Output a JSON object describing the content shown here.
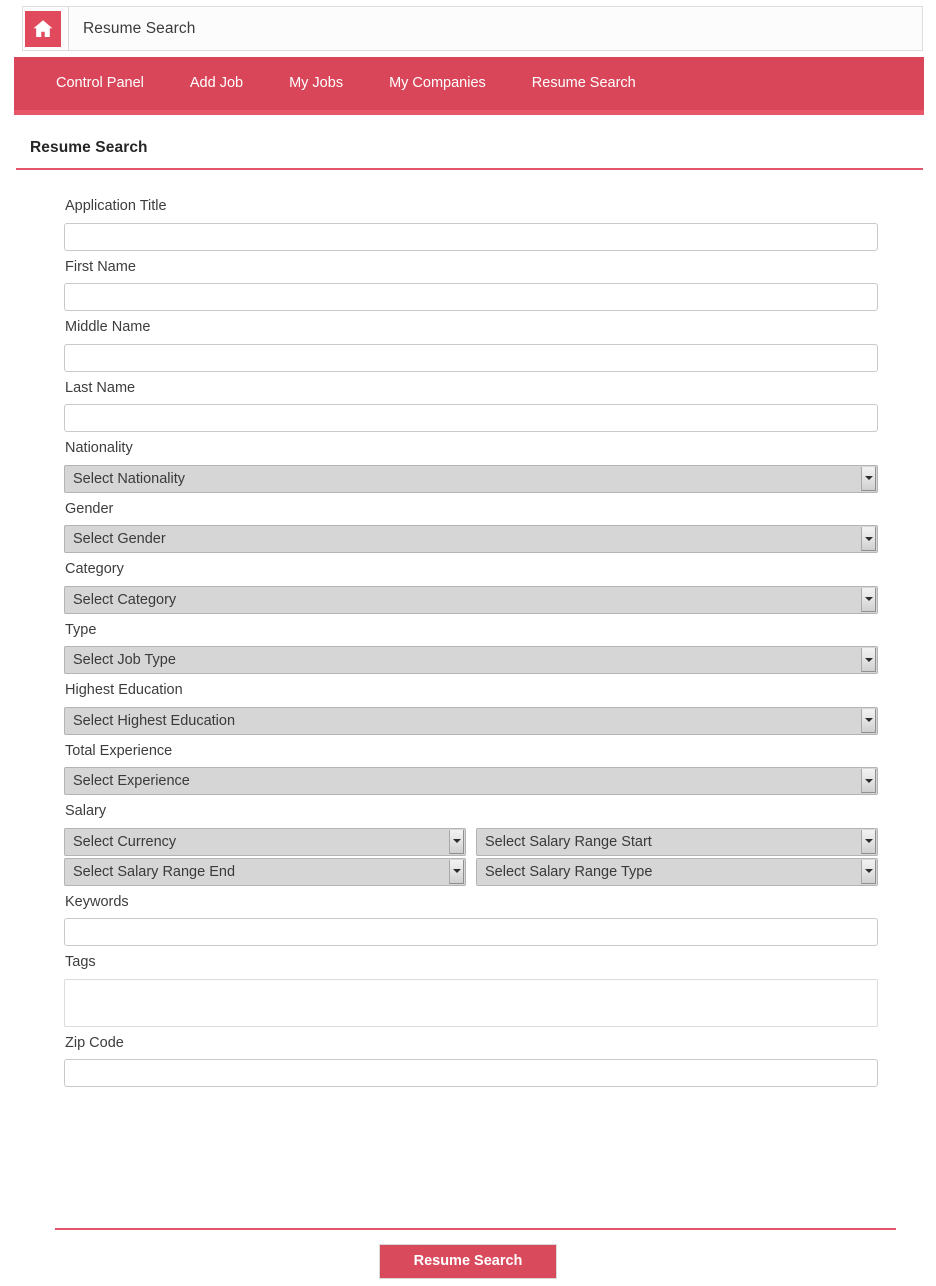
{
  "header": {
    "home_icon": "home-icon",
    "title": "Resume Search"
  },
  "nav": {
    "items": [
      {
        "label": "Control Panel",
        "name": "nav-item-control-panel"
      },
      {
        "label": "Add Job",
        "name": "nav-item-add-job"
      },
      {
        "label": "My Jobs",
        "name": "nav-item-my-jobs"
      },
      {
        "label": "My Companies",
        "name": "nav-item-my-companies"
      },
      {
        "label": "Resume Search",
        "name": "nav-item-resume-search"
      }
    ]
  },
  "page": {
    "heading": "Resume Search"
  },
  "form": {
    "application_title": {
      "label": "Application Title",
      "value": "",
      "placeholder": ""
    },
    "first_name": {
      "label": "First Name",
      "value": "",
      "placeholder": ""
    },
    "middle_name": {
      "label": "Middle Name",
      "value": "",
      "placeholder": ""
    },
    "last_name": {
      "label": "Last Name",
      "value": "",
      "placeholder": ""
    },
    "nationality": {
      "label": "Nationality",
      "selected": "Select Nationality"
    },
    "gender": {
      "label": "Gender",
      "selected": "Select Gender"
    },
    "category": {
      "label": "Category",
      "selected": "Select Category"
    },
    "type": {
      "label": "Type",
      "selected": "Select Job Type"
    },
    "highest_education": {
      "label": "Highest Education",
      "selected": "Select Highest Education"
    },
    "total_experience": {
      "label": "Total Experience",
      "selected": "Select Experience"
    },
    "salary": {
      "label": "Salary",
      "currency": "Select Currency",
      "range_start": "Select Salary Range Start",
      "range_end": "Select Salary Range End",
      "range_type": "Select Salary Range Type"
    },
    "keywords": {
      "label": "Keywords",
      "value": "",
      "placeholder": ""
    },
    "tags": {
      "label": "Tags",
      "value": "",
      "placeholder": ""
    },
    "zip_code": {
      "label": "Zip Code",
      "value": "",
      "placeholder": ""
    }
  },
  "footer": {
    "submit_label": "Resume Search"
  },
  "colors": {
    "brand_red": "#d9465a",
    "brand_red_light": "#e8566a",
    "rule_red": "#e2556a",
    "button_red": "#da4a5d",
    "select_bg": "#d6d6d6"
  }
}
